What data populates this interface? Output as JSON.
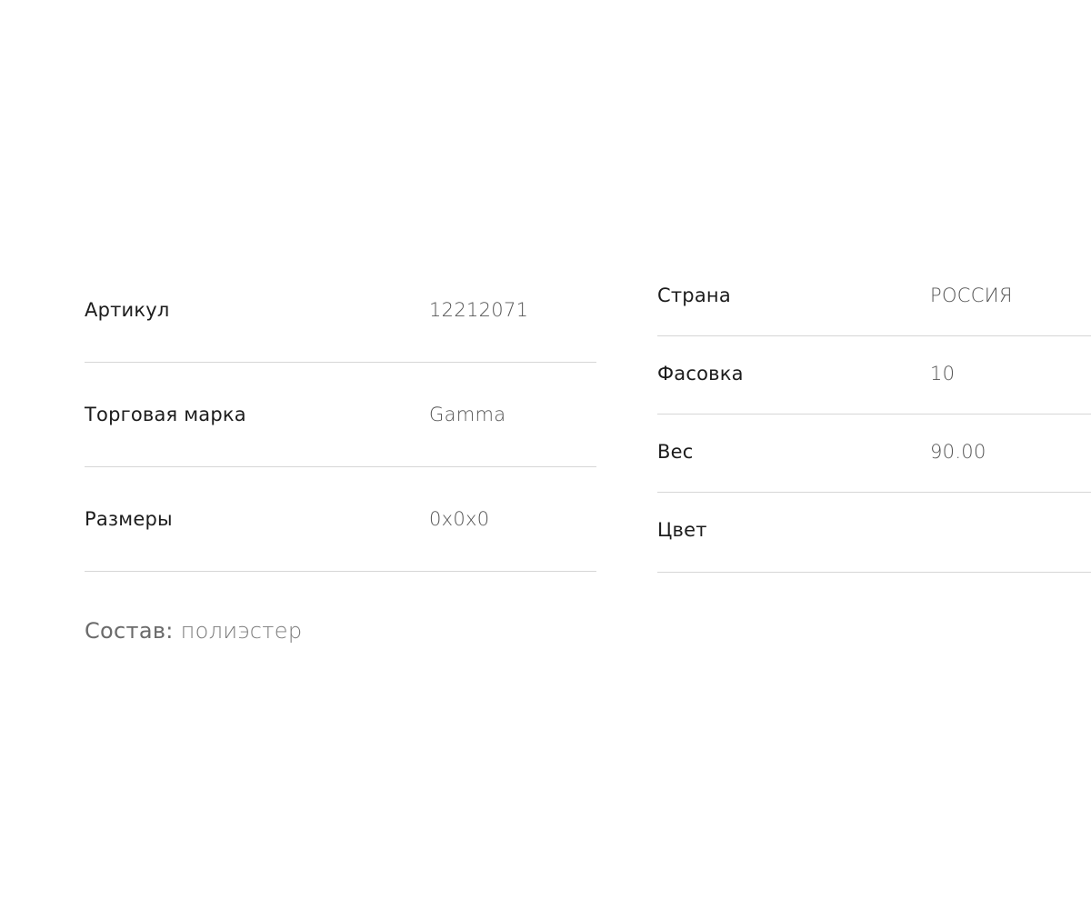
{
  "specs_left": [
    {
      "label": "Артикул",
      "value": "12212071"
    },
    {
      "label": "Торговая марка",
      "value": "Gamma"
    },
    {
      "label": "Размеры",
      "value": "0x0x0"
    }
  ],
  "specs_right": [
    {
      "label": "Страна",
      "value": "РОССИЯ"
    },
    {
      "label": "Фасовка",
      "value": "10"
    },
    {
      "label": "Вес",
      "value": "90.00"
    },
    {
      "label": "Цвет",
      "value": ""
    }
  ],
  "composition": {
    "label": "Состав:",
    "value": "полиэстер"
  },
  "colors": {
    "divider": "#d6d6d6",
    "label_text": "#1c1c1c",
    "value_text": "#555555"
  }
}
